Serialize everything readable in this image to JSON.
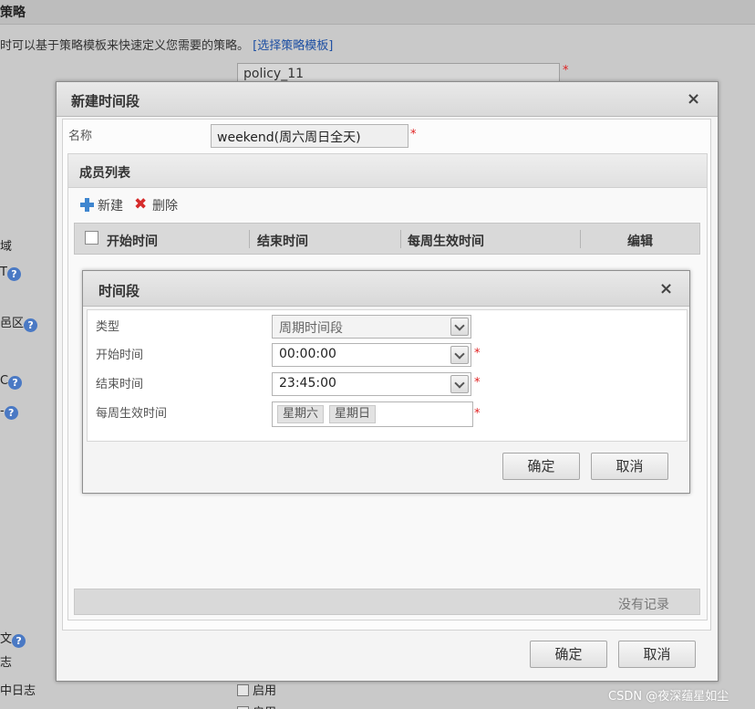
{
  "background": {
    "section_title": "策略",
    "description": "时可以基于策略模板来快速定义您需要的策略。",
    "template_link": "[选择策略模板]",
    "policy_name_value": "policy_11",
    "required_mark": "*",
    "left_labels": [
      "域",
      "T",
      "邑区",
      "C",
      "-",
      "文",
      "志",
      "中日志"
    ],
    "help_icon": "?",
    "checkbox_labels": [
      "启用",
      "启用"
    ],
    "watermark": "CSDN @夜深蕴星如尘"
  },
  "outer_dialog": {
    "title": "新建时间段",
    "close": "×",
    "name_label": "名称",
    "name_value": "weekend(周六周日全天)",
    "members_title": "成员列表",
    "toolbar": {
      "add_label": "新建",
      "delete_label": "删除"
    },
    "columns": [
      "开始时间",
      "结束时间",
      "每周生效时间",
      "编辑"
    ],
    "empty_text": "没有记录",
    "ok_label": "确定",
    "cancel_label": "取消"
  },
  "inner_dialog": {
    "title": "时间段",
    "close": "×",
    "type_label": "类型",
    "type_value": "周期时间段",
    "start_label": "开始时间",
    "start_value": "00:00:00",
    "end_label": "结束时间",
    "end_value": "23:45:00",
    "days_label": "每周生效时间",
    "days": [
      "星期六",
      "星期日"
    ],
    "ok_label": "确定",
    "cancel_label": "取消"
  },
  "colors": {
    "required": "#e02020",
    "link": "#1d4fa3",
    "help_icon": "#4a79c4",
    "add_icon": "#3f86cf",
    "delete_icon": "#d62b2b"
  }
}
